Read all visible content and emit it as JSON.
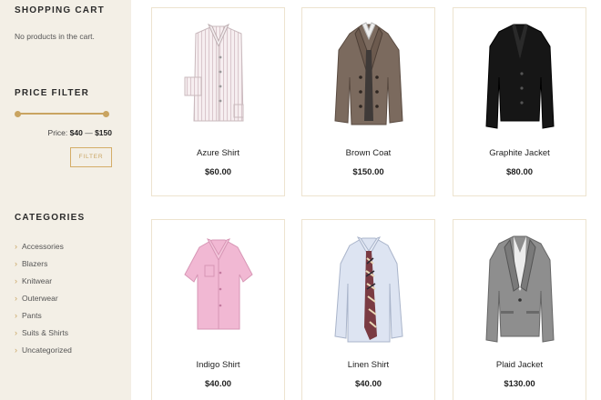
{
  "sidebar": {
    "cart": {
      "title": "SHOPPING CART",
      "empty_text": "No products in the cart."
    },
    "price_filter": {
      "title": "PRICE FILTER",
      "label": "Price:",
      "min": "$40",
      "separator": "—",
      "max": "$150",
      "button": "FILTER"
    },
    "categories": {
      "title": "CATEGORIES",
      "items": [
        {
          "label": "Accessories"
        },
        {
          "label": "Blazers"
        },
        {
          "label": "Knitwear"
        },
        {
          "label": "Outerwear"
        },
        {
          "label": "Pants"
        },
        {
          "label": "Suits & Shirts"
        },
        {
          "label": "Uncategorized"
        }
      ]
    }
  },
  "products": [
    {
      "name": "Azure Shirt",
      "price": "$60.00"
    },
    {
      "name": "Brown Coat",
      "price": "$150.00"
    },
    {
      "name": "Graphite Jacket",
      "price": "$80.00"
    },
    {
      "name": "Indigo Shirt",
      "price": "$40.00"
    },
    {
      "name": "Linen Shirt",
      "price": "$40.00"
    },
    {
      "name": "Plaid Jacket",
      "price": "$130.00"
    }
  ],
  "colors": {
    "sidebar_bg": "#f3efe6",
    "accent": "#c9a461",
    "card_border": "#ede3cf"
  }
}
